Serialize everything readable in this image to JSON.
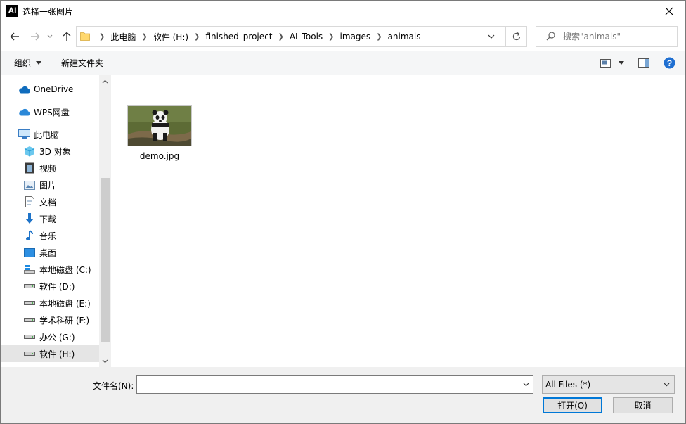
{
  "window": {
    "app_icon": "AI",
    "title": "选择一张图片"
  },
  "address": {
    "breadcrumbs": [
      "此电脑",
      "软件 (H:)",
      "finished_project",
      "AI_Tools",
      "images",
      "animals"
    ]
  },
  "search": {
    "placeholder": "搜索\"animals\""
  },
  "toolbar": {
    "organize_label": "组织",
    "new_folder_label": "新建文件夹"
  },
  "nav": {
    "items": [
      {
        "label": "OneDrive",
        "icon": "cloud-icon"
      },
      {
        "label": "WPS网盘",
        "icon": "cloud-icon"
      },
      {
        "label": "此电脑",
        "icon": "computer-icon"
      },
      {
        "label": "3D 对象",
        "icon": "cube-3d-icon"
      },
      {
        "label": "视频",
        "icon": "film-icon"
      },
      {
        "label": "图片",
        "icon": "picture-icon"
      },
      {
        "label": "文档",
        "icon": "document-icon"
      },
      {
        "label": "下载",
        "icon": "download-arrow-icon"
      },
      {
        "label": "音乐",
        "icon": "music-note-icon"
      },
      {
        "label": "桌面",
        "icon": "desktop-icon"
      },
      {
        "label": "本地磁盘 (C:)",
        "icon": "windows-drive-icon"
      },
      {
        "label": "软件 (D:)",
        "icon": "drive-icon"
      },
      {
        "label": "本地磁盘 (E:)",
        "icon": "drive-icon"
      },
      {
        "label": "学术科研 (F:)",
        "icon": "drive-icon"
      },
      {
        "label": "办公 (G:)",
        "icon": "drive-icon"
      },
      {
        "label": "软件 (H:)",
        "icon": "drive-icon",
        "selected": true
      }
    ]
  },
  "files": [
    {
      "name": "demo.jpg",
      "icon": "panda-thumbnail"
    }
  ],
  "bottom": {
    "filename_label": "文件名(N):",
    "filename_value": "",
    "filetype_value": "All Files (*)",
    "open_label": "打开(O)",
    "cancel_label": "取消"
  },
  "colors": {
    "accent": "#0078d7",
    "help": "#1f6fd1",
    "folder": "#ffd86e",
    "selected_bg": "#e5e5e5"
  }
}
